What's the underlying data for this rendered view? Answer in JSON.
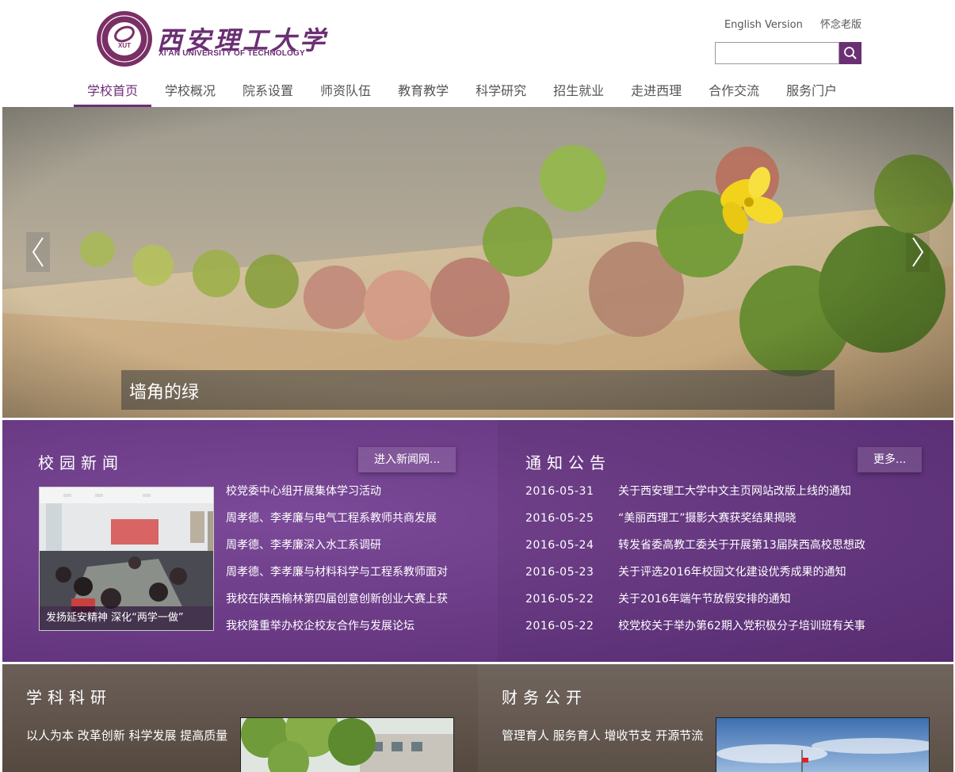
{
  "header": {
    "logo": {
      "seal_text": "XUT",
      "name_cn": "西安理工大学",
      "name_en": "XI'AN UNIVERSITY OF TECHNOLOGY"
    },
    "top_links": [
      "English Version",
      "怀念老版"
    ],
    "search": {
      "value": "",
      "placeholder": "",
      "icon": "search-icon"
    }
  },
  "nav": {
    "items": [
      "学校首页",
      "学校概况",
      "院系设置",
      "师资队伍",
      "教育教学",
      "科学研究",
      "招生就业",
      "走进西理",
      "合作交流",
      "服务门户"
    ],
    "active_index": 0
  },
  "banner": {
    "caption": "墙角的绿",
    "prev_icon": "chevron-left-icon",
    "next_icon": "chevron-right-icon"
  },
  "campus_news": {
    "title": "校园新闻",
    "more_label": "进入新闻网...",
    "photo_caption": "发扬延安精神 深化“两学一做”",
    "items": [
      "校党委中心组开展集体学习活动",
      "周孝德、李孝廉与电气工程系教师共商发展",
      "周孝德、李孝廉深入水工系调研",
      "周孝德、李孝廉与材料科学与工程系教师面对",
      "我校在陕西榆林第四届创意创新创业大赛上获",
      "我校隆重举办校企校友合作与发展论坛"
    ]
  },
  "notices": {
    "title": "通知公告",
    "more_label": "更多...",
    "items": [
      {
        "date": "2016-05-31",
        "text": "关于西安理工大学中文主页网站改版上线的通知"
      },
      {
        "date": "2016-05-25",
        "text": "“美丽西理工”摄影大赛获奖结果揭晓"
      },
      {
        "date": "2016-05-24",
        "text": "转发省委高教工委关于开展第13届陕西高校思想政"
      },
      {
        "date": "2016-05-23",
        "text": "关于评选2016年校园文化建设优秀成果的通知"
      },
      {
        "date": "2016-05-22",
        "text": "关于2016年端午节放假安排的通知"
      },
      {
        "date": "2016-05-22",
        "text": "校党校关于举办第62期入党积极分子培训班有关事"
      }
    ]
  },
  "research": {
    "title": "学科科研",
    "desc": "以人为本 改革创新 科学发展 提高质量"
  },
  "finance": {
    "title": "财务公开",
    "desc": "管理育人 服务育人 增收节支 开源节流"
  },
  "colors": {
    "brand_purple": "#6b2f73",
    "news_bg": "#6a3a85",
    "bottom_bg": "#5b4f4a"
  }
}
